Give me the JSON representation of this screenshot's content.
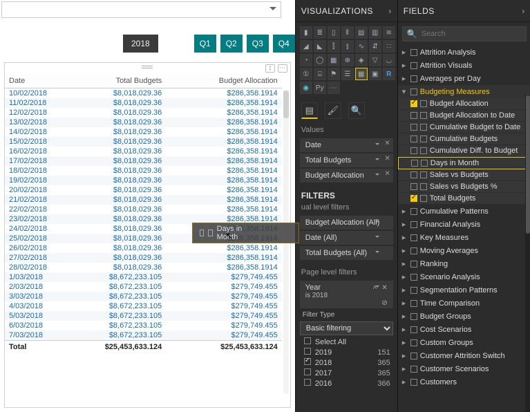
{
  "slicers": {
    "year": "2018",
    "quarters": [
      "Q1",
      "Q2",
      "Q3",
      "Q4"
    ]
  },
  "table": {
    "columns": [
      "Date",
      "Total Budgets",
      "Budget Allocation"
    ],
    "rows": [
      {
        "date": "10/02/2018",
        "tb": "$8,018,029.36",
        "ba": "$286,358.1914"
      },
      {
        "date": "11/02/2018",
        "tb": "$8,018,029.36",
        "ba": "$286,358.1914"
      },
      {
        "date": "12/02/2018",
        "tb": "$8,018,029.36",
        "ba": "$286,358.1914"
      },
      {
        "date": "13/02/2018",
        "tb": "$8,018,029.36",
        "ba": "$286,358.1914"
      },
      {
        "date": "14/02/2018",
        "tb": "$8,018,029.36",
        "ba": "$286,358.1914"
      },
      {
        "date": "15/02/2018",
        "tb": "$8,018,029.36",
        "ba": "$286,358.1914"
      },
      {
        "date": "16/02/2018",
        "tb": "$8,018,029.36",
        "ba": "$286,358.1914"
      },
      {
        "date": "17/02/2018",
        "tb": "$8,018,029.36",
        "ba": "$286,358.1914"
      },
      {
        "date": "18/02/2018",
        "tb": "$8,018,029.36",
        "ba": "$286,358.1914"
      },
      {
        "date": "19/02/2018",
        "tb": "$8,018,029.36",
        "ba": "$286,358.1914"
      },
      {
        "date": "20/02/2018",
        "tb": "$8,018,029.36",
        "ba": "$286,358.1914"
      },
      {
        "date": "21/02/2018",
        "tb": "$8,018,029.36",
        "ba": "$286,358.1914"
      },
      {
        "date": "22/02/2018",
        "tb": "$8,018,029.36",
        "ba": "$286,358.1914"
      },
      {
        "date": "23/02/2018",
        "tb": "$8,018,029.36",
        "ba": "$286,358.1914"
      },
      {
        "date": "24/02/2018",
        "tb": "$8,018,029.36",
        "ba": "$286,358.1914"
      },
      {
        "date": "25/02/2018",
        "tb": "$8,018,029.36",
        "ba": "$286,358.1914"
      },
      {
        "date": "26/02/2018",
        "tb": "$8,018,029.36",
        "ba": "$286,358.1914"
      },
      {
        "date": "27/02/2018",
        "tb": "$8,018,029.36",
        "ba": "$286,358.1914"
      },
      {
        "date": "28/02/2018",
        "tb": "$8,018,029.36",
        "ba": "$286,358.1914"
      },
      {
        "date": "1/03/2018",
        "tb": "$8,672,233.105",
        "ba": "$279,749.455"
      },
      {
        "date": "2/03/2018",
        "tb": "$8,672,233.105",
        "ba": "$279,749.455"
      },
      {
        "date": "3/03/2018",
        "tb": "$8,672,233.105",
        "ba": "$279,749.455"
      },
      {
        "date": "4/03/2018",
        "tb": "$8,672,233.105",
        "ba": "$279,749.455"
      },
      {
        "date": "5/03/2018",
        "tb": "$8,672,233.105",
        "ba": "$279,749.455"
      },
      {
        "date": "6/03/2018",
        "tb": "$8,672,233.105",
        "ba": "$279,749.455"
      },
      {
        "date": "7/03/2018",
        "tb": "$8,672,233.105",
        "ba": "$279,749.455"
      }
    ],
    "total": {
      "label": "Total",
      "tb": "$25,453,633.124",
      "ba": "$25,453,633.124"
    }
  },
  "drag_chip": {
    "label": "Days in Month"
  },
  "viz_pane": {
    "title": "VISUALIZATIONS",
    "values_label": "Values",
    "wells": [
      "Date",
      "Total Budgets",
      "Budget Allocation"
    ],
    "filters_title": "FILTERS",
    "visual_level_label": "ual level filters",
    "visual_filters": [
      "Budget Allocation (All)",
      "Date (All)",
      "Total Budgets (All)"
    ],
    "page_level_label": "Page level filters",
    "year_filter": {
      "name": "Year",
      "summary": "is 2018",
      "type_label": "Filter Type",
      "type_value": "Basic filtering",
      "options": [
        {
          "label": "Select All",
          "count": "",
          "checked": false
        },
        {
          "label": "2019",
          "count": "151",
          "checked": false
        },
        {
          "label": "2018",
          "count": "365",
          "checked": true
        },
        {
          "label": "2017",
          "count": "365",
          "checked": false
        },
        {
          "label": "2016",
          "count": "366",
          "checked": false
        }
      ]
    }
  },
  "fields_pane": {
    "title": "FIELDS",
    "search_placeholder": "Search",
    "tables_before": [
      "Attrition Analysis",
      "Attrition Visuals",
      "Averages per Day"
    ],
    "expanded_table": {
      "name": "Budgeting Measures",
      "fields": [
        {
          "label": "Budget Allocation",
          "checked": true,
          "highlight": false
        },
        {
          "label": "Budget Allocation to Date",
          "checked": false,
          "highlight": false
        },
        {
          "label": "Cumulative Budget to Date",
          "checked": false,
          "highlight": false
        },
        {
          "label": "Cumulative Budgets",
          "checked": false,
          "highlight": false
        },
        {
          "label": "Cumulative Diff. to Budget",
          "checked": false,
          "highlight": false
        },
        {
          "label": "Days in Month",
          "checked": false,
          "highlight": true
        },
        {
          "label": "Sales vs Budgets",
          "checked": false,
          "highlight": false
        },
        {
          "label": "Sales vs Budgets %",
          "checked": false,
          "highlight": false
        },
        {
          "label": "Total Budgets",
          "checked": true,
          "highlight": false
        }
      ]
    },
    "tables_after": [
      "Cumulative Patterns",
      "Financial Analysis",
      "Key Measures",
      "Moving Averages",
      "Ranking",
      "Scenario Analysis",
      "Segmentation Patterns",
      "Time Comparison",
      "Budget Groups",
      "Cost Scenarios",
      "Custom Groups",
      "Customer Attrition Switch",
      "Customer Scenarios",
      "Customers"
    ]
  }
}
